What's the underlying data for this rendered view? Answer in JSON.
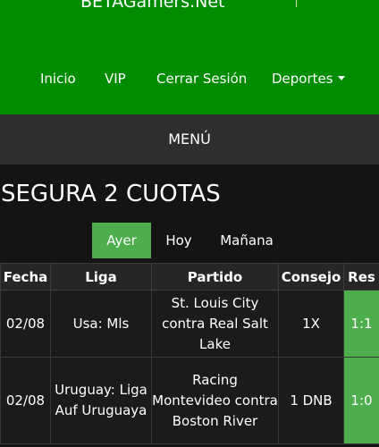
{
  "header": {
    "brand": "BETAGamers.Net",
    "nav": [
      {
        "label": "Inicio"
      },
      {
        "label": "VIP"
      },
      {
        "label": "Cerrar Sesión"
      },
      {
        "label": "Deportes"
      }
    ]
  },
  "menu": {
    "label": "MENÚ"
  },
  "page": {
    "title": "SEGURA 2 CUOTAS"
  },
  "tabs": [
    {
      "label": "Ayer",
      "active": true
    },
    {
      "label": "Hoy",
      "active": false
    },
    {
      "label": "Mañana",
      "active": false
    }
  ],
  "table": {
    "headers": [
      "Fecha",
      "Liga",
      "Partido",
      "Consejo",
      "Res"
    ],
    "rows": [
      {
        "fecha": "02/08",
        "liga": "Usa: Mls",
        "partido": "St. Louis City contra Real Salt Lake",
        "consejo": "1X",
        "res": "1:1"
      },
      {
        "fecha": "02/08",
        "liga": "Uruguay: Liga Auf Uruguaya",
        "partido": "Racing Montevideo contra Boston River",
        "consejo": "1 DNB",
        "res": "1:0"
      }
    ]
  },
  "colors": {
    "header_green": "#008c00",
    "accent_green": "#4cae4c",
    "background": "#141414",
    "menubar": "#2e2e2e"
  },
  "icons": {
    "deportes_dropdown": "caret-down-icon"
  }
}
